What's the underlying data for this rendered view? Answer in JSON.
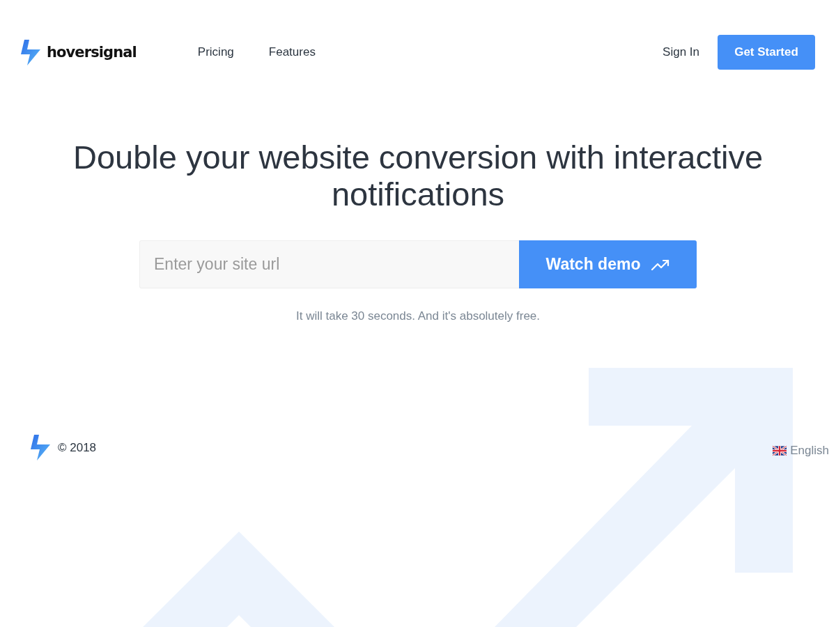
{
  "header": {
    "logo_text": "hoversignal",
    "nav": [
      "Pricing",
      "Features"
    ],
    "sign_in": "Sign In",
    "cta": "Get Started"
  },
  "hero": {
    "title": "Double your website conversion with interactive notifications",
    "url_field": {
      "placeholder": "Enter your site url"
    },
    "submit": "Watch demo",
    "note": "It will take 30 seconds. And it's absolutely free."
  },
  "footer": {
    "copyright": "© 2018",
    "language": "English"
  }
}
